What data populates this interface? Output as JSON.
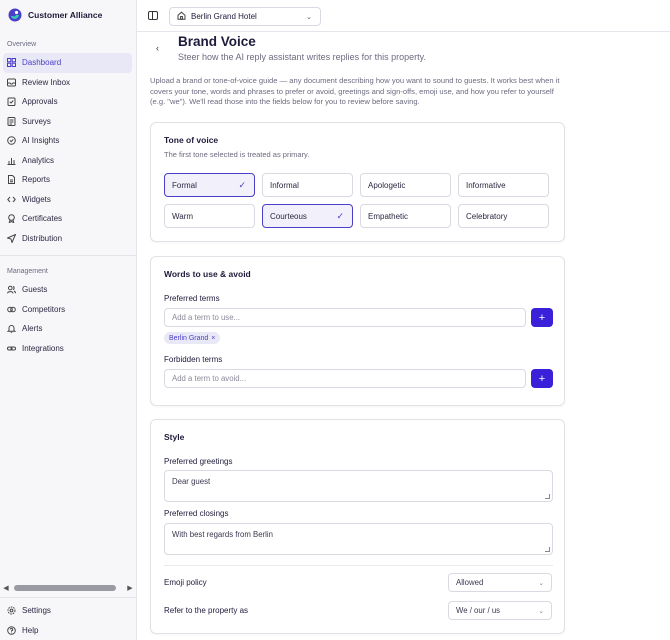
{
  "app": {
    "name": "Customer Alliance"
  },
  "sidebar": {
    "overview_label": "Overview",
    "overview_items": [
      {
        "label": "Dashboard",
        "icon": "grid-icon",
        "active": true
      },
      {
        "label": "Review Inbox",
        "icon": "inbox-icon"
      },
      {
        "label": "Approvals",
        "icon": "clipboard-check-icon"
      },
      {
        "label": "Surveys",
        "icon": "survey-icon"
      },
      {
        "label": "AI Insights",
        "icon": "ai-chip-icon"
      },
      {
        "label": "Analytics",
        "icon": "bar-chart-icon"
      },
      {
        "label": "Reports",
        "icon": "document-icon"
      },
      {
        "label": "Widgets",
        "icon": "code-icon"
      },
      {
        "label": "Certificates",
        "icon": "badge-icon"
      },
      {
        "label": "Distribution",
        "icon": "send-icon"
      }
    ],
    "management_label": "Management",
    "management_items": [
      {
        "label": "Guests",
        "icon": "users-icon"
      },
      {
        "label": "Competitors",
        "icon": "competitors-icon"
      },
      {
        "label": "Alerts",
        "icon": "bell-icon"
      },
      {
        "label": "Integrations",
        "icon": "link-icon"
      }
    ],
    "footer_items": [
      {
        "label": "Settings",
        "icon": "gear-icon"
      },
      {
        "label": "Help",
        "icon": "help-icon"
      }
    ]
  },
  "topbar": {
    "property": "Berlin Grand Hotel"
  },
  "page": {
    "title": "Brand Voice",
    "subtitle": "Steer how the AI reply assistant writes replies for this property.",
    "intro": "Upload a brand or tone-of-voice guide — any document describing how you want to sound to guests. It works best when it covers your tone, words and phrases to prefer or avoid, greetings and sign-offs, emoji use, and how you refer to yourself (e.g. \"we\"). We'll read those into the fields below for you to review before saving."
  },
  "tone": {
    "title": "Tone of voice",
    "subtitle": "The first tone selected is treated as primary.",
    "options": [
      {
        "label": "Formal",
        "selected": true
      },
      {
        "label": "Informal",
        "selected": false
      },
      {
        "label": "Apologetic",
        "selected": false
      },
      {
        "label": "Informative",
        "selected": false
      },
      {
        "label": "Warm",
        "selected": false
      },
      {
        "label": "Courteous",
        "selected": true
      },
      {
        "label": "Empathetic",
        "selected": false
      },
      {
        "label": "Celebratory",
        "selected": false
      }
    ]
  },
  "words": {
    "title": "Words to use & avoid",
    "preferred_label": "Preferred terms",
    "preferred_placeholder": "Add a term to use...",
    "preferred_chips": [
      "Berlin Grand"
    ],
    "forbidden_label": "Forbidden terms",
    "forbidden_placeholder": "Add a term to avoid..."
  },
  "style": {
    "title": "Style",
    "greetings_label": "Preferred greetings",
    "greetings_value": "Dear guest",
    "closings_label": "Preferred closings",
    "closings_value": "With best regards from Berlin",
    "emoji_label": "Emoji policy",
    "emoji_value": "Allowed",
    "refer_label": "Refer to the property as",
    "refer_value": "We / our / us"
  },
  "colors": {
    "accent": "#3a20d9",
    "active_bg": "#e9e8f6",
    "active_text": "#4b3fc9"
  }
}
